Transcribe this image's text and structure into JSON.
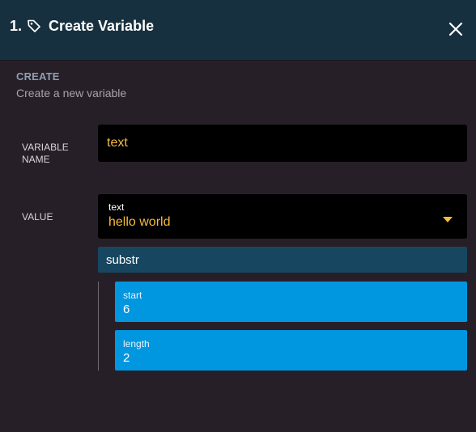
{
  "header": {
    "step": "1.",
    "title": "Create Variable",
    "icon": "tag-icon",
    "close_icon": "close-icon",
    "background": "#17303f"
  },
  "section": {
    "title": "CREATE",
    "subtitle": "Create a new variable"
  },
  "variable_name": {
    "label_line1": "VARIABLE",
    "label_line2": "NAME",
    "value": "text"
  },
  "value": {
    "label": "VALUE",
    "type": "text",
    "value": "hello world",
    "caret_icon": "caret-down-icon"
  },
  "function": {
    "name": "substr",
    "params": [
      {
        "label": "start",
        "value": "6"
      },
      {
        "label": "length",
        "value": "2"
      }
    ]
  },
  "colors": {
    "accent_value": "#f6bb3f",
    "param_bg": "#0096e0",
    "function_bg": "#174760",
    "page_bg": "#271f27"
  }
}
